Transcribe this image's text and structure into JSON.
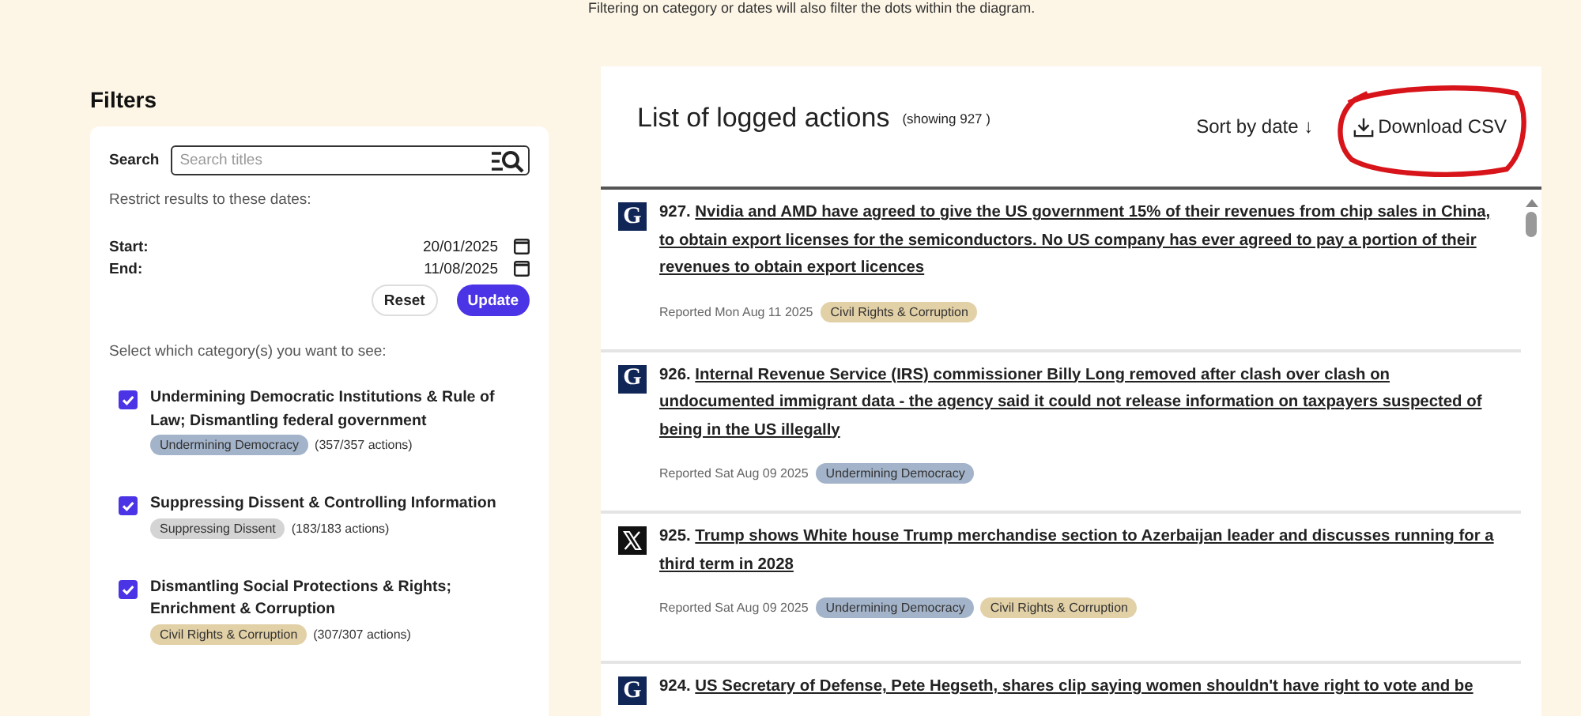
{
  "notice": "Filtering on category or dates will also filter the dots within the diagram.",
  "filters": {
    "title": "Filters",
    "search": {
      "label": "Search",
      "placeholder": "Search titles"
    },
    "dates_intro": "Restrict results to these dates:",
    "dates": [
      {
        "label": "Start:",
        "value": "20/01/2025"
      },
      {
        "label": "End:",
        "value": "11/08/2025"
      }
    ],
    "buttons": [
      {
        "label": "Reset",
        "kind": "secondary"
      },
      {
        "label": "Update",
        "kind": "primary"
      }
    ],
    "categories_intro": "Select which category(s) you want to see:",
    "categories": [
      {
        "title": "Undermining Democratic Institutions & Rule of Law; Dismantling federal government",
        "tag": "Undermining Democracy",
        "color": "#a3b3c9",
        "count": "(357/357 actions)",
        "checked": true
      },
      {
        "title": "Suppressing Dissent & Controlling Information",
        "tag": "Suppressing Dissent",
        "color": "#d4d4d4",
        "count": "(183/183 actions)",
        "checked": true
      },
      {
        "title": "Dismantling Social Protections & Rights; Enrichment & Corruption",
        "tag": "Civil Rights & Corruption",
        "color": "#e2d0a6",
        "count": "(307/307 actions)",
        "checked": true
      }
    ]
  },
  "list": {
    "title": "List of logged actions",
    "showing": "(showing 927 )",
    "sort": "Sort by date ↓",
    "download": "Download CSV",
    "items": [
      {
        "glyph": "G",
        "number": "927.",
        "title": "Nvidia and AMD have agreed to give the US government 15% of their revenues from chip sales in China, to obtain export licenses for the semiconductors. No US company has ever agreed to pay a portion of their revenues to obtain export licences",
        "reported": "Reported Mon Aug 11 2025",
        "tags": [
          {
            "label": "Civil Rights & Corruption",
            "color": "#e2d0a6"
          }
        ]
      },
      {
        "glyph": "G",
        "number": "926.",
        "title": "Internal Revenue Service (IRS) commissioner Billy Long removed after clash over clash on undocumented immigrant data - the agency said it could not release information on taxpayers suspected of being in the US illegally",
        "reported": "Reported Sat Aug 09 2025",
        "tags": [
          {
            "label": "Undermining Democracy",
            "color": "#a3b3c9"
          }
        ]
      },
      {
        "number": "925.",
        "title": "Trump shows White house Trump merchandise section to Azerbaijan leader and discusses running for a third term in 2028",
        "reported": "Reported Sat Aug 09 2025",
        "tags": [
          {
            "label": "Undermining Democracy",
            "color": "#a3b3c9"
          },
          {
            "label": "Civil Rights & Corruption",
            "color": "#e2d0a6"
          }
        ]
      },
      {
        "glyph": "G",
        "number": "924.",
        "title": "US Secretary of Defense, Pete Hegseth, shares clip saying women shouldn't have right to vote and be"
      }
    ]
  }
}
